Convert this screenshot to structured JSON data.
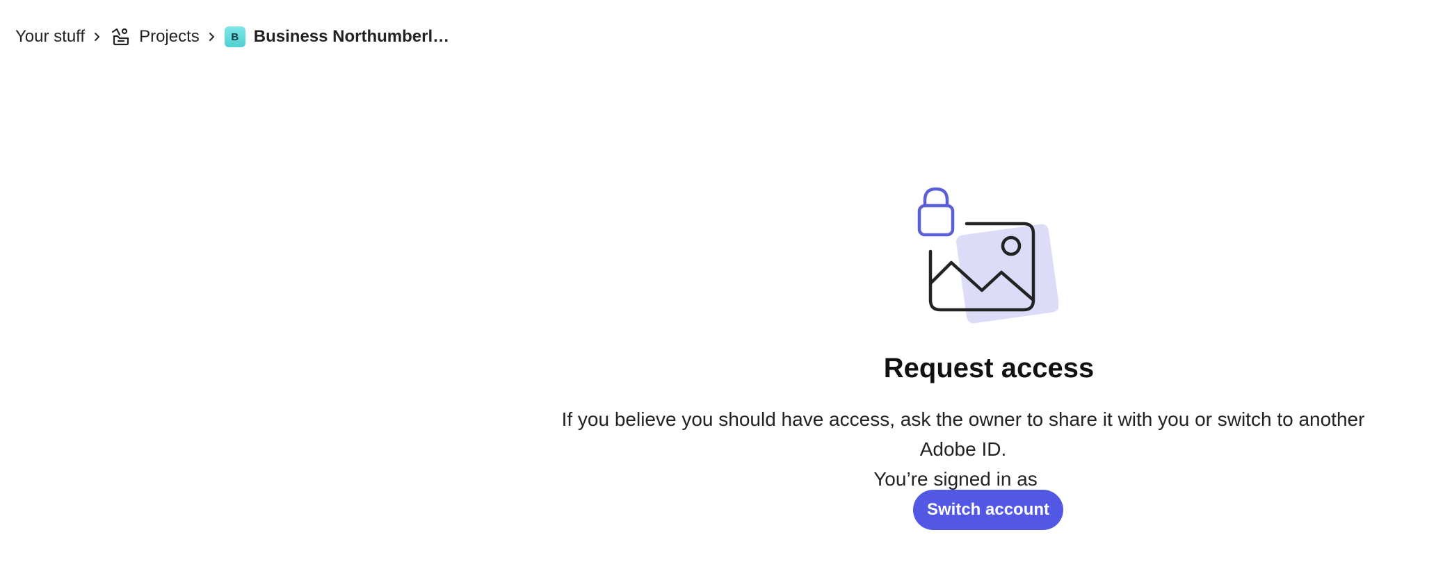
{
  "breadcrumb": {
    "your_stuff": "Your stuff",
    "projects": "Projects",
    "project_badge": "B",
    "current": "Business Northumberla…"
  },
  "icons": {
    "separator": "chevron-right-icon",
    "projects": "projects-icon",
    "illustration": "locked-image-illustration"
  },
  "main": {
    "title": "Request access",
    "message_line1": "If you believe you should have access, ask the owner to share it with you or switch to another Adobe ID.",
    "message_line2": "You’re signed in as",
    "switch_button": "Switch account"
  },
  "colors": {
    "accent": "#5258e4",
    "lock": "#5b5fd6",
    "illustration_bg": "#dcdcf8",
    "project_badge": "#4fd0d3"
  }
}
